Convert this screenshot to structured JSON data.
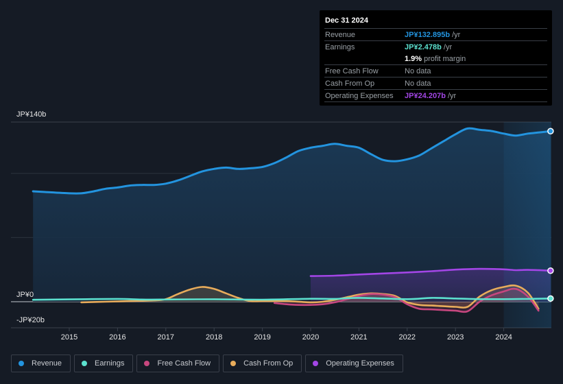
{
  "tooltip": {
    "date": "Dec 31 2024",
    "rows": [
      {
        "label": "Revenue",
        "value": "JP¥132.895b",
        "suffix": " /yr",
        "color": "#2394df"
      },
      {
        "label": "Earnings",
        "value": "JP¥2.478b",
        "suffix": " /yr",
        "color": "#5ce1cf"
      },
      {
        "label": "",
        "value": "1.9%",
        "suffix": " profit margin",
        "color": "#ffffff"
      },
      {
        "label": "Free Cash Flow",
        "value": "",
        "suffix": "No data",
        "color": "#9aa0a6"
      },
      {
        "label": "Cash From Op",
        "value": "",
        "suffix": "No data",
        "color": "#9aa0a6"
      },
      {
        "label": "Operating Expenses",
        "value": "JP¥24.207b",
        "suffix": " /yr",
        "color": "#a346e6"
      }
    ]
  },
  "legend": [
    {
      "label": "Revenue",
      "color": "#2394df"
    },
    {
      "label": "Earnings",
      "color": "#5ce1cf"
    },
    {
      "label": "Free Cash Flow",
      "color": "#c7477f"
    },
    {
      "label": "Cash From Op",
      "color": "#e8ac5b"
    },
    {
      "label": "Operating Expenses",
      "color": "#a346e6"
    }
  ],
  "chart_data": {
    "type": "area",
    "title": "",
    "xlabel": "",
    "ylabel": "",
    "y_tick_labels": [
      "JP¥140b",
      "JP¥0",
      "-JP¥20b"
    ],
    "x_tick_labels": [
      "2015",
      "2016",
      "2017",
      "2018",
      "2019",
      "2020",
      "2021",
      "2022",
      "2023",
      "2024"
    ],
    "ylim": [
      -20,
      140
    ],
    "xlim": [
      2014.0,
      2025.0
    ],
    "grid": true,
    "legend_position": "bottom",
    "forecast_shade_from": 2024.0,
    "series": [
      {
        "name": "Revenue",
        "color": "#2394df",
        "x": [
          2014.25,
          2014.5,
          2015.0,
          2015.25,
          2015.5,
          2015.75,
          2016.0,
          2016.25,
          2016.5,
          2016.75,
          2017.0,
          2017.25,
          2017.5,
          2017.75,
          2018.0,
          2018.25,
          2018.5,
          2018.75,
          2019.0,
          2019.25,
          2019.5,
          2019.75,
          2020.0,
          2020.25,
          2020.5,
          2020.75,
          2021.0,
          2021.25,
          2021.5,
          2021.75,
          2022.0,
          2022.25,
          2022.5,
          2022.75,
          2023.0,
          2023.25,
          2023.5,
          2023.75,
          2024.0,
          2024.25,
          2024.5,
          2024.75,
          2024.97
        ],
        "values": [
          86,
          85.5,
          84.5,
          84.5,
          86,
          88,
          89,
          90.5,
          91,
          91,
          92,
          94.5,
          98,
          101.5,
          103.5,
          104.5,
          103.5,
          104,
          105,
          108,
          112.5,
          117.5,
          120,
          121.5,
          123,
          121.5,
          120,
          115,
          110.5,
          109.5,
          111,
          114,
          119.5,
          125,
          130.5,
          135,
          134,
          133,
          131,
          129.5,
          131,
          132,
          132.9
        ]
      },
      {
        "name": "Earnings",
        "color": "#5ce1cf",
        "x": [
          2014.25,
          2015.0,
          2016.0,
          2016.5,
          2017.0,
          2018.0,
          2019.0,
          2020.0,
          2020.5,
          2021.0,
          2022.0,
          2022.5,
          2023.0,
          2023.5,
          2024.0,
          2024.5,
          2024.97
        ],
        "values": [
          1.5,
          1.8,
          2.2,
          1.7,
          1.7,
          1.9,
          1.6,
          2.3,
          2.2,
          3.0,
          2.0,
          3.0,
          2.5,
          2.0,
          2.0,
          2.2,
          2.5
        ]
      },
      {
        "name": "Free Cash Flow",
        "color": "#c7477f",
        "x": [
          2019.25,
          2019.5,
          2019.75,
          2020.0,
          2020.25,
          2020.5,
          2020.75,
          2021.0,
          2021.25,
          2021.5,
          2021.75,
          2022.0,
          2022.25,
          2022.5,
          2022.75,
          2023.0,
          2023.25,
          2023.5,
          2023.75,
          2024.0,
          2024.25,
          2024.5,
          2024.72
        ],
        "values": [
          -1,
          -2,
          -2.5,
          -2.5,
          -2,
          -0.5,
          2,
          4.5,
          6,
          5.5,
          3.5,
          -2,
          -5.5,
          -6,
          -6.5,
          -7,
          -7.5,
          0,
          5,
          8,
          10,
          4,
          -7
        ]
      },
      {
        "name": "Cash From Op",
        "color": "#e8ac5b",
        "x": [
          2015.25,
          2015.75,
          2016.25,
          2016.75,
          2017.0,
          2017.25,
          2017.5,
          2017.75,
          2018.0,
          2018.25,
          2018.5,
          2018.75,
          2019.0,
          2019.5,
          2020.0,
          2020.25,
          2020.5,
          2020.75,
          2021.0,
          2021.25,
          2021.5,
          2021.75,
          2022.0,
          2022.25,
          2022.5,
          2022.75,
          2023.0,
          2023.25,
          2023.5,
          2023.75,
          2024.0,
          2024.25,
          2024.5,
          2024.72
        ],
        "values": [
          -0.5,
          0,
          0.5,
          1,
          2,
          6,
          9.5,
          11.5,
          10,
          6.5,
          3,
          0.5,
          0.5,
          0.5,
          -0.5,
          0,
          1.5,
          3.5,
          5.5,
          6.5,
          6,
          4.5,
          -0.5,
          -2.5,
          -3,
          -3.5,
          -4,
          -4,
          4,
          9,
          11.5,
          12.5,
          7,
          -5.5
        ]
      },
      {
        "name": "Operating Expenses",
        "color": "#a346e6",
        "x": [
          2020.0,
          2020.5,
          2021.0,
          2021.5,
          2022.0,
          2022.5,
          2023.0,
          2023.5,
          2024.0,
          2024.25,
          2024.5,
          2024.97
        ],
        "values": [
          20,
          20.3,
          21.2,
          22,
          22.8,
          23.8,
          25,
          25.6,
          25.2,
          24.6,
          24.8,
          24.2
        ]
      }
    ]
  }
}
